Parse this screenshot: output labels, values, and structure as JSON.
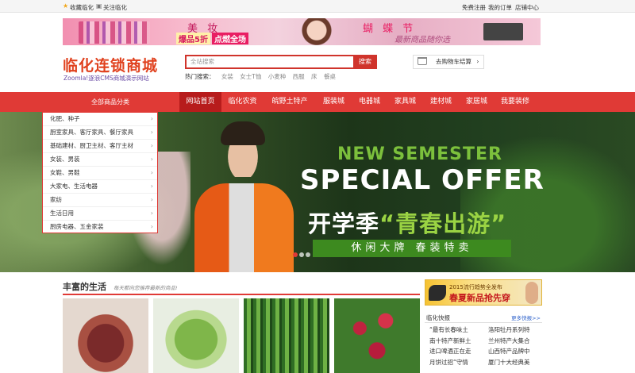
{
  "topbar": {
    "bookmark": "收藏临化",
    "follow": "关注临化",
    "register": "免费注册",
    "orders": "我的订单",
    "store_center": "店铺中心"
  },
  "banner": {
    "title1": "美 妆",
    "promo1": "爆品5折",
    "promo2": "点燃全场",
    "title2": "蝴 蝶 节",
    "tagline": "最新商品随你选"
  },
  "logo": {
    "name": "临化连锁商城",
    "subtitle": "Zoomla!逐浪CMS商城演示网站"
  },
  "search": {
    "placeholder": "全站搜索",
    "button_label": "搜索",
    "hot_label": "热门搜索：",
    "hot_keywords": [
      "女装",
      "女士T恤",
      "小麦种",
      "西服",
      "床",
      "餐桌"
    ]
  },
  "cart": {
    "label": "去购物车结算",
    "arrow": "›"
  },
  "nav": {
    "all_categories": "全部商品分类",
    "items": [
      "网站首页",
      "临化农资",
      "皖野土特产",
      "服装城",
      "电器城",
      "家具城",
      "建材城",
      "家居城",
      "我要装修"
    ],
    "active_index": 0
  },
  "categories": [
    "化肥、种子",
    "厨室家具、客厅家具、餐厅家具",
    "基础建材、厨卫主材、客厅主材",
    "女装、男装",
    "女鞋、男鞋",
    "大家电、生活电器",
    "家纺",
    "生活日用",
    "厨房电器、五金家装"
  ],
  "hero": {
    "line1": "NEW SEMESTER",
    "line2": "SPECIAL OFFER",
    "cn_part1": "开学季",
    "cn_part2": "“青春出游”",
    "band": "休闲大牌 春装特卖",
    "slide_count": 3,
    "active_slide": 0
  },
  "section": {
    "title": "丰富的生活",
    "subtitle": "每天都向您推荐最新的商品!"
  },
  "side_ad": {
    "line1": "2015流行趋势全发布",
    "line2": "春夏新品抢先穿"
  },
  "news": {
    "title": "临化快报",
    "more": "更多快报>>",
    "left": [
      "“最有长春味土",
      "南十特产新鲜土",
      "进口啤酒正在走",
      "月饼过招“守情"
    ],
    "right": [
      "洛阳牡丹系列特",
      "兰州特产大集合",
      "山西特产品牌中",
      "厦门十大经典美"
    ]
  },
  "colors": {
    "accent": "#e03a36",
    "active_nav": "#b71c1c",
    "hero_green": "#7cc03c"
  }
}
